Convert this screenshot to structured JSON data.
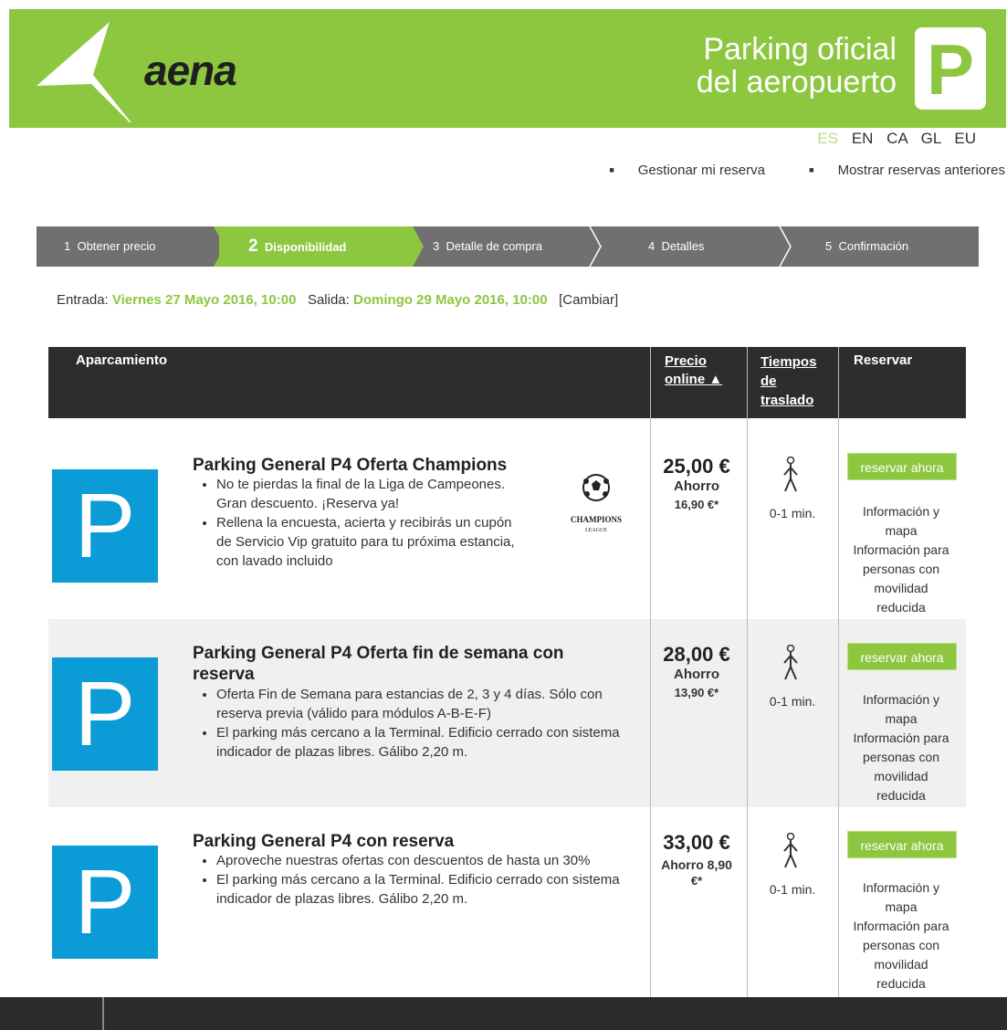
{
  "header": {
    "logo": "aena",
    "title_line1": "Parking oficial",
    "title_line2": "del aeropuerto",
    "badge": "P"
  },
  "languages": [
    "ES",
    "EN",
    "CA",
    "GL",
    "EU"
  ],
  "active_language": "ES",
  "top_links": [
    "Gestionar mi reserva",
    "Mostrar reservas anteriores"
  ],
  "steps": [
    {
      "num": "1",
      "label": "Obtener precio"
    },
    {
      "num": "2",
      "label": "Disponibilidad"
    },
    {
      "num": "3",
      "label": "Detalle de compra"
    },
    {
      "num": "4",
      "label": "Detalles"
    },
    {
      "num": "5",
      "label": "Confirmación"
    }
  ],
  "dates": {
    "entry_label": "Entrada:",
    "entry_value": "Viernes 27 Mayo 2016, 10:00",
    "exit_label": "Salida:",
    "exit_value": "Domingo 29 Mayo 2016, 10:00",
    "change": "[Cambiar]"
  },
  "table_header": {
    "parking": "Aparcamiento",
    "price_line1": "Precio",
    "price_line2": "online ▲",
    "time_line1": "Tiempos",
    "time_line2": "de",
    "time_line3": "traslado",
    "reserve": "Reservar"
  },
  "rows": [
    {
      "title": "Parking General P4 Oferta Champions",
      "bullets": [
        "No te pierdas la final de la Liga de Campeones. Gran descuento. ¡Reserva ya!",
        "Rellena la encuesta, acierta y recibirás un cupón de Servicio Vip gratuito para tu próxima estancia, con lavado incluido"
      ],
      "price": "25,00 €",
      "saving_line1": "Ahorro",
      "saving_line2": "16,90 €*",
      "time": "0-1 min.",
      "button": "reservar ahora",
      "info": [
        "Información y",
        "mapa",
        "Información para",
        "personas con",
        "movilidad",
        "reducida"
      ],
      "badge_text": "CHAMPIONS",
      "badge_sub": "LEAGUE"
    },
    {
      "title": "Parking General P4 Oferta fin de semana con reserva",
      "bullets": [
        "Oferta Fin de Semana para estancias de 2, 3 y 4 días. Sólo con reserva previa (válido para módulos A-B-E-F)",
        "El parking más cercano a la Terminal. Edificio cerrado con sistema indicador de plazas libres. Gálibo 2,20 m."
      ],
      "price": "28,00 €",
      "saving_line1": "Ahorro",
      "saving_line2": "13,90 €*",
      "time": "0-1 min.",
      "button": "reservar ahora",
      "info": [
        "Información y",
        "mapa",
        "Información para",
        "personas con",
        "movilidad",
        "reducida"
      ]
    },
    {
      "title": "Parking General P4 con reserva",
      "bullets": [
        "Aproveche nuestras ofertas con descuentos de hasta un 30%",
        "El parking más cercano a la Terminal. Edificio cerrado con sistema indicador de plazas libres. Gálibo 2,20 m."
      ],
      "price": "33,00 €",
      "saving_line1": "Ahorro 8,90",
      "saving_line2": "€*",
      "time": "0-1 min.",
      "button": "reservar ahora",
      "info": [
        "Información y",
        "mapa",
        "Información para",
        "personas con",
        "movilidad",
        "reducida"
      ]
    }
  ],
  "colors": {
    "brand_green": "#8dc63f",
    "parking_blue": "#0b9bd7",
    "dark": "#2d2d2d"
  }
}
